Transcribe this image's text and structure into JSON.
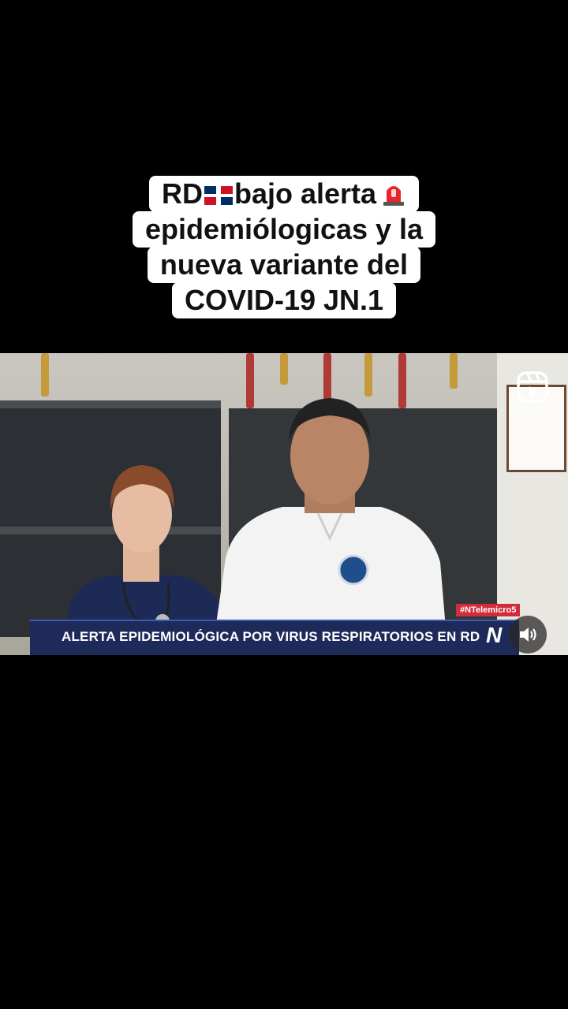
{
  "caption": {
    "line1_a": "RD",
    "line1_b": "bajo alerta",
    "line2": "epidemiólogicas y la",
    "line3": "nueva variante del",
    "line4": "COVID-19 JN.1"
  },
  "video": {
    "lower_third": "ALERTA EPIDEMIOLÓGICA POR VIRUS RESPIRATORIOS EN RD",
    "hashtag": "#NTelemicro5",
    "channel_logo": "N"
  },
  "icons": {
    "flag": "dominican-flag-icon",
    "siren": "police-light-icon",
    "reels": "reels-icon",
    "volume": "volume-icon"
  },
  "colors": {
    "lower_third_bg": "#1e2a5a",
    "tag_bg": "#d22b3a",
    "caption_bg": "#ffffff"
  }
}
